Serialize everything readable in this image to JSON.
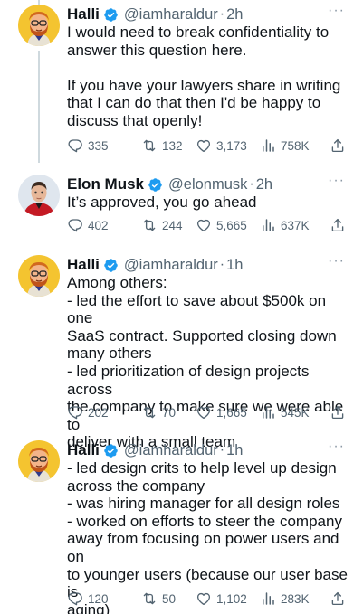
{
  "tweets": [
    {
      "name": "Halli",
      "handle": "@iamharaldur",
      "separator": "·",
      "time": "2h",
      "text": "I would need to break confidentiality to\nanswer this question here.\n\nIf you have your lawyers share in writing\nthat I can do that then I'd be happy to\ndiscuss that openly!",
      "replies": "335",
      "retweets": "132",
      "likes": "3,173",
      "views": "758K",
      "avatar_icon": "cartoon-avatar-icon"
    },
    {
      "name": "Elon Musk",
      "handle": "@elonmusk",
      "separator": "·",
      "time": "2h",
      "text": "It’s approved, you go ahead",
      "replies": "402",
      "retweets": "244",
      "likes": "5,665",
      "views": "637K",
      "avatar_icon": "photo-avatar-icon"
    },
    {
      "name": "Halli",
      "handle": "@iamharaldur",
      "separator": "·",
      "time": "1h",
      "text": "Among others:\n- led the effort to save about $500k on one\nSaaS contract. Supported closing down\nmany others\n- led prioritization of design projects across\nthe company to make sure we were able to\ndeliver with a small team",
      "replies": "202",
      "retweets": "70",
      "likes": "1,665",
      "views": "545K",
      "avatar_icon": "cartoon-avatar-icon"
    },
    {
      "name": "Halli",
      "handle": "@iamharaldur",
      "separator": "·",
      "time": "1h",
      "text": "- led design crits to help level up design\nacross the company\n- was hiring manager for all design roles\n- worked on efforts to steer the company\naway from focusing on power users and on\nto younger users (because our user base is\naging)",
      "replies": "120",
      "retweets": "50",
      "likes": "1,102",
      "views": "283K",
      "avatar_icon": "cartoon-avatar-icon"
    }
  ],
  "icons": {
    "more": "more-icon",
    "verified": "verified-badge-icon",
    "reply": "reply-icon",
    "retweet": "retweet-icon",
    "like": "like-icon",
    "views": "views-icon",
    "share": "share-icon"
  },
  "more_glyph": "···",
  "colors": {
    "text": "#0f1419",
    "secondary": "#536471",
    "verified": "#1d9bf0",
    "thread_line": "#cfd9de",
    "background": "#ffffff"
  }
}
